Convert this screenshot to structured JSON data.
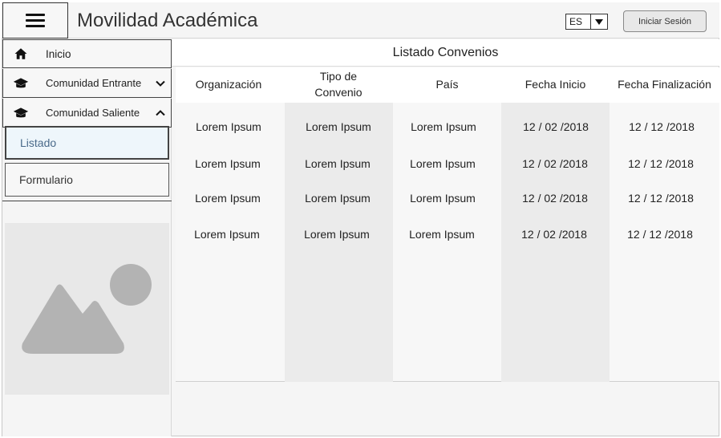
{
  "header": {
    "title": "Movilidad Académica",
    "language": "ES",
    "login_label": "Iniciar Sesión"
  },
  "sidebar": {
    "items": [
      {
        "label": "Inicio",
        "icon": "home-icon"
      },
      {
        "label": "Comunidad Entrante",
        "icon": "graduation-cap-icon",
        "expanded": false
      },
      {
        "label": "Comunidad Saliente",
        "icon": "graduation-cap-icon",
        "expanded": true
      }
    ],
    "sub_items": [
      {
        "label": "Listado",
        "active": true
      },
      {
        "label": "Formulario",
        "active": false
      }
    ]
  },
  "main": {
    "title": "Listado Convenios",
    "columns": [
      "Organización",
      "Tipo de Convenio",
      "País",
      "Fecha Inicio",
      "Fecha Finalización"
    ],
    "rows": [
      [
        "Lorem Ipsum",
        "Lorem Ipsum",
        "Lorem Ipsum",
        "12 / 02 /2018",
        "12 / 12 /2018"
      ],
      [
        "Lorem Ipsum",
        "Lorem Ipsum",
        "Lorem Ipsum",
        "12 / 02 /2018",
        "12 / 12 /2018"
      ],
      [
        "Lorem Ipsum",
        "Lorem Ipsum",
        "Lorem Ipsum",
        "12 / 02 /2018",
        "12 / 12 /2018"
      ],
      [
        "Lorem Ipsum",
        "Lorem Ipsum",
        "Lorem Ipsum",
        "12 / 02 /2018",
        "12 / 12 /2018"
      ]
    ]
  },
  "colors": {
    "active_sub_bg": "#eef6fb",
    "active_sub_text": "#4a6a8a",
    "shaded_column": "#ebebeb"
  }
}
